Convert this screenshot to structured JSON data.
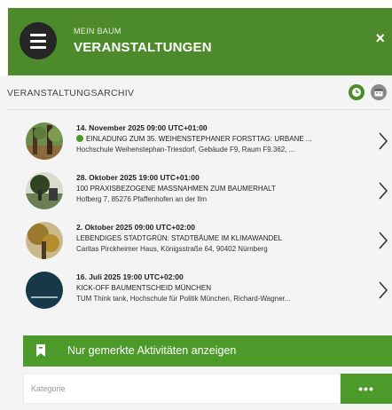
{
  "header": {
    "subtitle": "MEIN BAUM",
    "title": "VERANSTALTUNGEN",
    "close_label": "×",
    "menu_icon": "hamburger-menu-icon",
    "color": "#4c8a2b"
  },
  "archive": {
    "section_title": "VERANSTALTUNGSARCHIV",
    "clock_icon": "clock-icon",
    "calendar_icon": "calendar-icon"
  },
  "events": [
    {
      "date": "14. November 2025 09:00 UTC+01:00",
      "title": "EINLADUNG ZUM 35. WEIHENSTEPHANER FORSTTAG: URBANE ...",
      "location": "Hochschule Weihenstephan-Triesdorf, Gebäude F9, Raum F9.362, ...",
      "has_status_dot": true,
      "thumb_icon": "forest-photo"
    },
    {
      "date": "28. Oktober 2025 19:00 UTC+01:00",
      "title": "100 PRAXISBEZOGENE MASSNAHMEN ZUM BAUMERHALT",
      "location": "Hofberg 7, 85276 Pfaffenhofen an der Ilm",
      "has_status_dot": false,
      "thumb_icon": "tree-photo"
    },
    {
      "date": "2. Oktober 2025 09:00 UTC+02:00",
      "title": "LEBENDIGES STADTGRÜN: STADTBÄUME IM KLIMAWANDEL",
      "location": "Caritas Pirckheimer Haus, Königsstraße 64, 90402 Nürnberg",
      "has_status_dot": false,
      "thumb_icon": "autumn-tree-photo"
    },
    {
      "date": "16. Juli 2025 19:00 UTC+02:00",
      "title": "KICK-OFF BAUMENTSCHEID MÜNCHEN",
      "location": "TUM Think tank, Hochschule für Politik München, Richard-Wagner...",
      "has_status_dot": false,
      "thumb_icon": "logo-photo"
    }
  ],
  "filters": {
    "bookmark_label": "Nur gemerkte Aktivitäten anzeigen",
    "bookmark_icon": "bookmark-icon",
    "category_placeholder": "Kategorie",
    "category_button_label": "•••"
  },
  "colors": {
    "accent": "#4c9a2a",
    "header": "#4c8a2b",
    "menu_button": "#262626"
  }
}
